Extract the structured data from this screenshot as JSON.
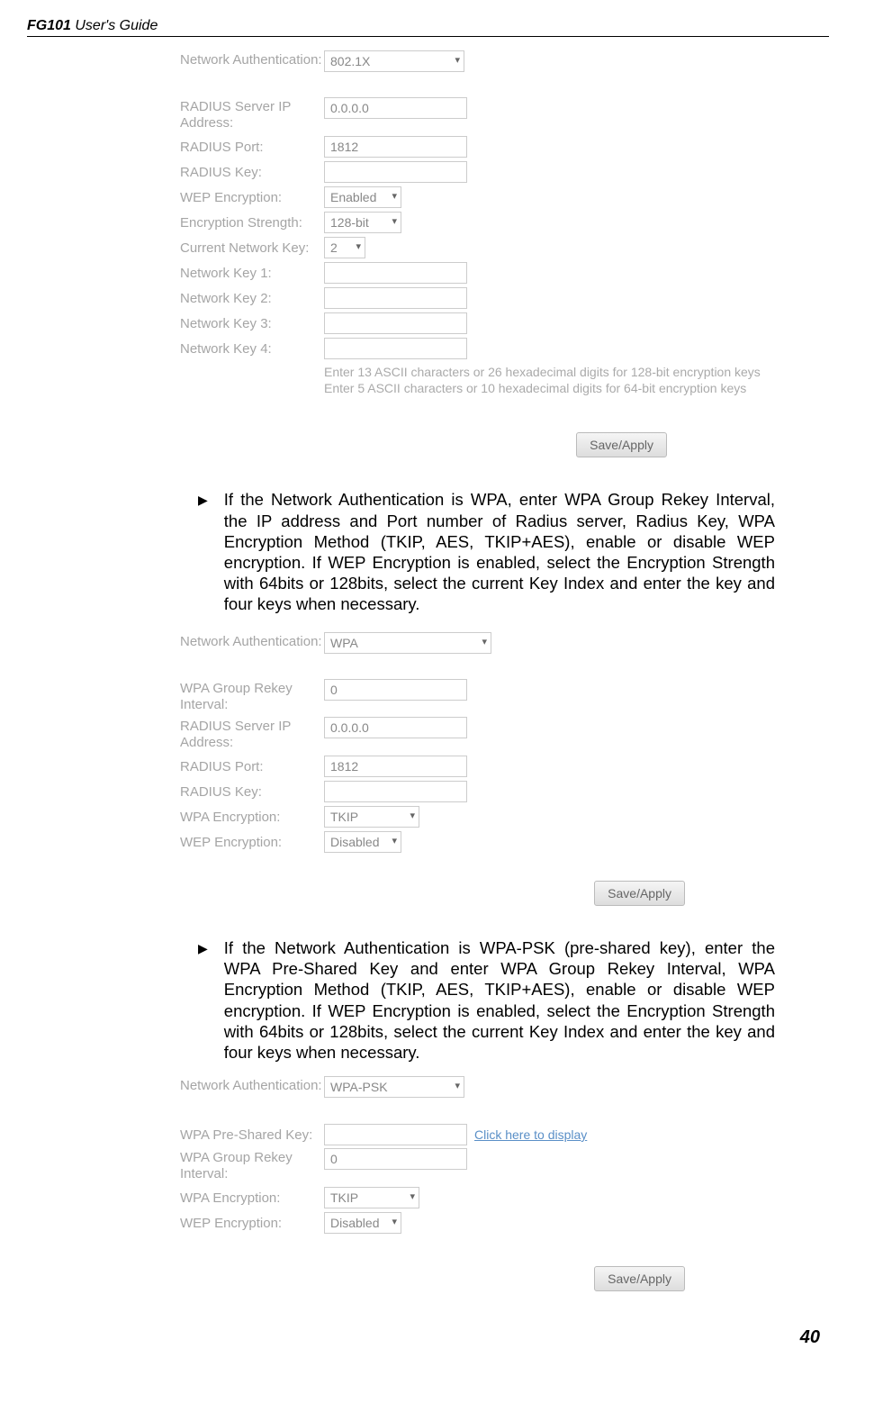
{
  "header": {
    "title": "FG101",
    "sub": " User's Guide"
  },
  "form1": {
    "labels": {
      "netauth": "Network Authentication:",
      "radiusIp": "RADIUS Server IP Address:",
      "radiusPort": "RADIUS Port:",
      "radiusKey": "RADIUS Key:",
      "wepEnc": "WEP Encryption:",
      "encStr": "Encryption Strength:",
      "curKey": "Current Network Key:",
      "nk1": "Network Key 1:",
      "nk2": "Network Key 2:",
      "nk3": "Network Key 3:",
      "nk4": "Network Key 4:"
    },
    "values": {
      "netauth": "802.1X",
      "radiusIp": "0.0.0.0",
      "radiusPort": "1812",
      "radiusKey": "",
      "wepEnc": "Enabled",
      "encStr": "128-bit",
      "curKey": "2",
      "nk1": "",
      "nk2": "",
      "nk3": "",
      "nk4": ""
    },
    "hint1": "Enter 13 ASCII characters or 26 hexadecimal digits for 128-bit encryption keys",
    "hint2": "Enter 5 ASCII characters or 10 hexadecimal digits for 64-bit encryption keys",
    "button": "Save/Apply"
  },
  "para1": "If the Network Authentication is WPA, enter WPA Group Rekey Interval, the IP address and Port number of Radius server, Radius Key, WPA Encryption Method (TKIP, AES, TKIP+AES), enable or disable WEP encryption. If WEP Encryption is enabled, select the Encryption Strength with 64bits or 128bits, select the current Key Index and enter the key and four keys when necessary.",
  "form2": {
    "labels": {
      "netauth": "Network Authentication:",
      "rekey": "WPA Group Rekey Interval:",
      "radiusIp": "RADIUS Server IP Address:",
      "radiusPort": "RADIUS Port:",
      "radiusKey": "RADIUS Key:",
      "wpaEnc": "WPA Encryption:",
      "wepEnc": "WEP Encryption:"
    },
    "values": {
      "netauth": "WPA",
      "rekey": "0",
      "radiusIp": "0.0.0.0",
      "radiusPort": "1812",
      "radiusKey": "",
      "wpaEnc": "TKIP",
      "wepEnc": "Disabled"
    },
    "button": "Save/Apply"
  },
  "para2": "If the Network Authentication is WPA-PSK (pre-shared key), enter the WPA Pre-Shared Key and enter WPA Group Rekey Interval, WPA Encryption Method (TKIP, AES, TKIP+AES), enable or disable WEP encryption. If WEP Encryption is enabled, select the Encryption Strength with 64bits or 128bits, select the current Key Index and enter the key and four keys when necessary.",
  "form3": {
    "labels": {
      "netauth": "Network Authentication:",
      "psk": "WPA Pre-Shared Key:",
      "rekey": "WPA Group Rekey Interval:",
      "wpaEnc": "WPA Encryption:",
      "wepEnc": "WEP Encryption:"
    },
    "values": {
      "netauth": "WPA-PSK",
      "psk": "",
      "rekey": "0",
      "wpaEnc": "TKIP",
      "wepEnc": "Disabled"
    },
    "link": "Click here to display",
    "button": "Save/Apply"
  },
  "pageNum": "40"
}
